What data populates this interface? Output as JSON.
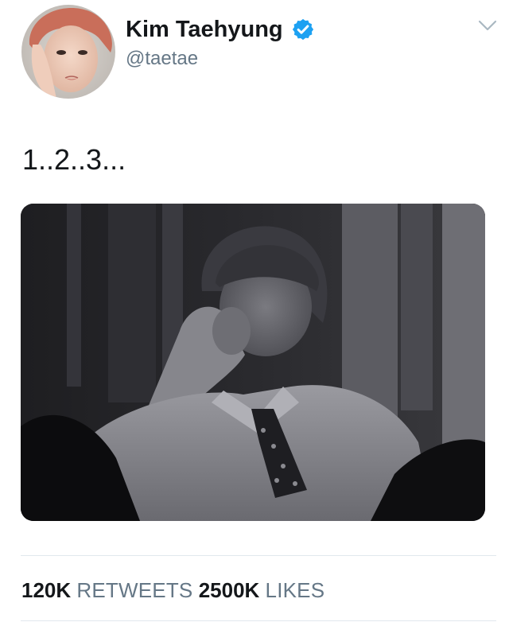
{
  "user": {
    "display_name": "Kim Taehyung",
    "handle": "@taetae",
    "verified": true,
    "verified_icon": "verified-badge-icon",
    "avatar_icon": "profile-avatar"
  },
  "menu": {
    "icon": "chevron-down-icon"
  },
  "tweet": {
    "text": "1..2..3...",
    "media_icon": "tweet-photo"
  },
  "stats": {
    "retweets_count": "120K",
    "retweets_label": "RETWEETS",
    "likes_count": "2500K",
    "likes_label": "LIKES"
  },
  "colors": {
    "text_primary": "#14171a",
    "text_secondary": "#657786",
    "verified_blue": "#1da1f2",
    "divider": "#e1e8ed"
  }
}
